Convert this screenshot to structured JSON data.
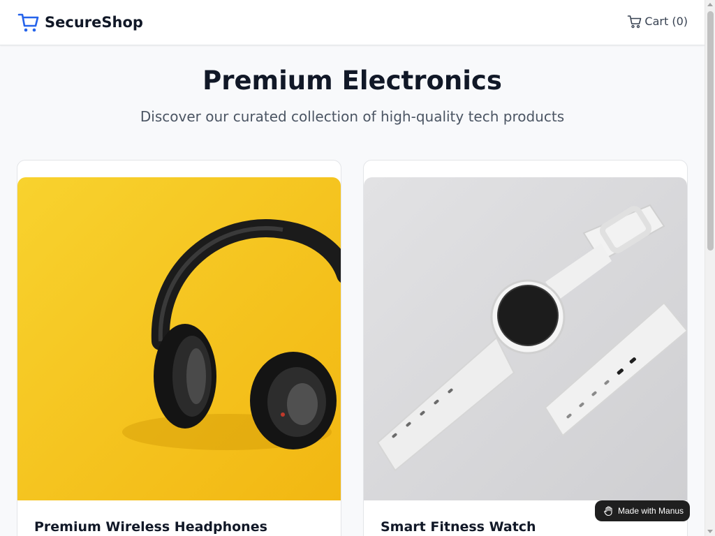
{
  "header": {
    "brand_name": "SecureShop",
    "brand_icon": "shopping-cart-icon",
    "cart_label": "Cart (0)",
    "cart_icon": "shopping-cart-icon"
  },
  "hero": {
    "title": "Premium Electronics",
    "subtitle": "Discover our curated collection of high-quality tech products"
  },
  "products": [
    {
      "title": "Premium Wireless Headphones",
      "image_background": "#f5c518"
    },
    {
      "title": "Smart Fitness Watch",
      "image_background": "#d9d9db"
    }
  ],
  "badge": {
    "label": "Made with Manus",
    "icon": "manus-hand-icon"
  },
  "colors": {
    "brand_accent": "#2563eb",
    "badge_background": "#1f1f1f"
  }
}
